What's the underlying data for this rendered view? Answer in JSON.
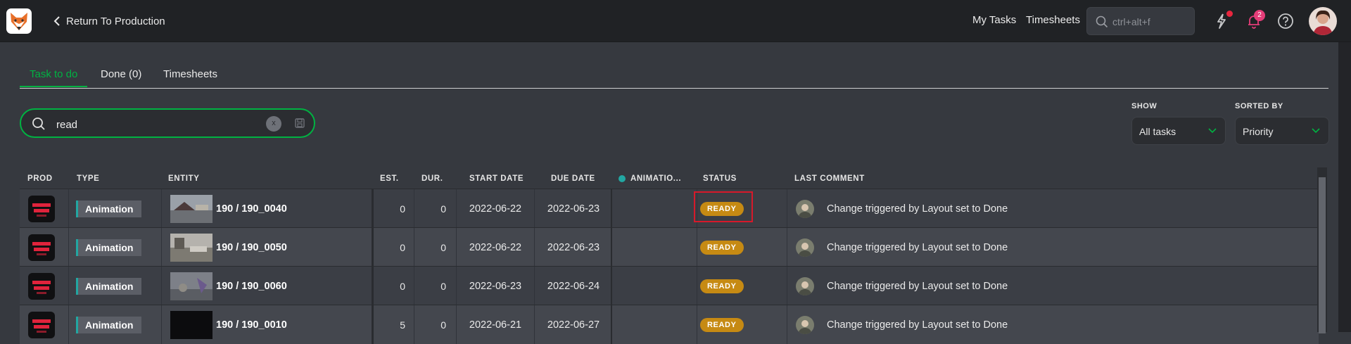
{
  "topbar": {
    "back_label": "Return To Production",
    "nav": [
      "My Tasks",
      "Timesheets"
    ],
    "search_placeholder": "ctrl+alt+f",
    "notification_count": "2"
  },
  "tabs": [
    {
      "label": "Task to do",
      "active": true
    },
    {
      "label": "Done (0)",
      "active": false
    },
    {
      "label": "Timesheets",
      "active": false
    }
  ],
  "search": {
    "value": "read",
    "clear_label": "x"
  },
  "filters": {
    "show": {
      "label": "SHOW",
      "value": "All tasks"
    },
    "sorted_by": {
      "label": "SORTED BY",
      "value": "Priority"
    }
  },
  "table": {
    "headers": {
      "prod": "PROD",
      "type": "TYPE",
      "entity": "ENTITY",
      "est": "EST.",
      "dur": "DUR.",
      "start": "START DATE",
      "due": "DUE DATE",
      "anim": "ANIMATIO...",
      "status": "STATUS",
      "comment": "LAST COMMENT"
    },
    "rows": [
      {
        "type": "Animation",
        "entity": "190 / 190_0040",
        "est": "0",
        "dur": "0",
        "start": "2022-06-22",
        "due": "2022-06-23",
        "status": "READY",
        "comment": "Change triggered by Layout set to Done"
      },
      {
        "type": "Animation",
        "entity": "190 / 190_0050",
        "est": "0",
        "dur": "0",
        "start": "2022-06-22",
        "due": "2022-06-23",
        "status": "READY",
        "comment": "Change triggered by Layout set to Done"
      },
      {
        "type": "Animation",
        "entity": "190 / 190_0060",
        "est": "0",
        "dur": "0",
        "start": "2022-06-23",
        "due": "2022-06-24",
        "status": "READY",
        "comment": "Change triggered by Layout set to Done"
      },
      {
        "type": "Animation",
        "entity": "190 / 190_0010",
        "est": "5",
        "dur": "0",
        "start": "2022-06-21",
        "due": "2022-06-27",
        "status": "READY",
        "comment": "Change triggered by Layout set to Done"
      }
    ]
  },
  "colors": {
    "accent": "#00b242",
    "status_ready": "#c68a13",
    "type_bar": "#22a7a2",
    "highlight": "#d7192a"
  }
}
